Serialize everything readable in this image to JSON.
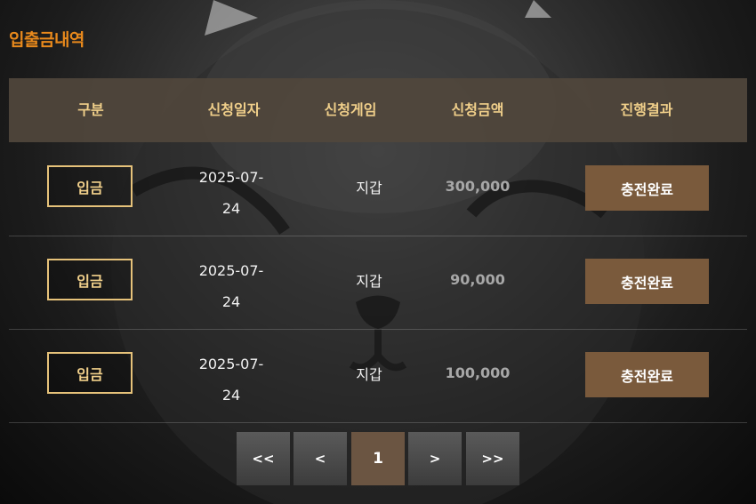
{
  "page": {
    "title": "입출금내역"
  },
  "table": {
    "headers": [
      "구분",
      "신청일자",
      "신청게임",
      "신청금액",
      "진행결과"
    ],
    "rows": [
      {
        "type": "입금",
        "date_line1": "2025-07-",
        "date_line2": "24",
        "game": "지갑",
        "amount": "300,000",
        "status": "충전완료"
      },
      {
        "type": "입금",
        "date_line1": "2025-07-",
        "date_line2": "24",
        "game": "지갑",
        "amount": "90,000",
        "status": "충전완료"
      },
      {
        "type": "입금",
        "date_line1": "2025-07-",
        "date_line2": "24",
        "game": "지갑",
        "amount": "100,000",
        "status": "충전완료"
      }
    ]
  },
  "pagination": {
    "first": "<<",
    "prev": "<",
    "current": "1",
    "next": ">",
    "last": ">>"
  },
  "colors": {
    "title": "#e8891c",
    "header_text": "#f0cf8a",
    "badge_border": "#e6c27a",
    "status_bg": "#7a5a3c",
    "amount_text": "#a7a7a7"
  }
}
